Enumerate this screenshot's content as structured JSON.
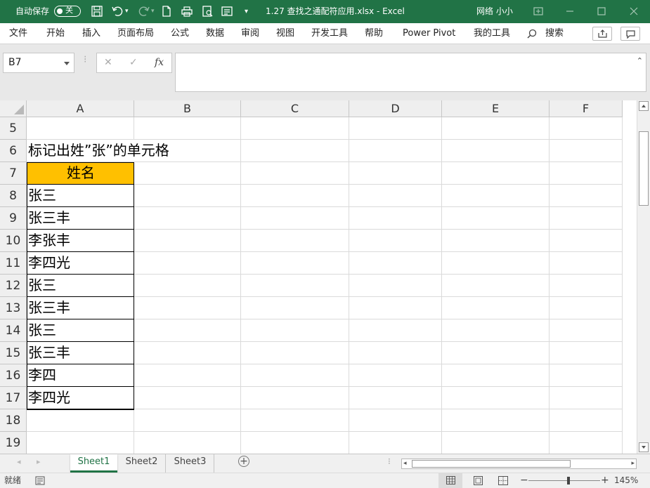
{
  "titlebar": {
    "autosave_label": "自动保存",
    "autosave_state": "关",
    "title": "1.27 查找之通配符应用.xlsx  -  Excel",
    "user": "网络 小小",
    "qat_more": "▾",
    "bg_color": "#217346"
  },
  "menu": {
    "items": [
      "文件",
      "开始",
      "插入",
      "页面布局",
      "公式",
      "数据",
      "审阅",
      "视图",
      "开发工具",
      "帮助",
      "Power Pivot",
      "我的工具"
    ],
    "search": "搜索"
  },
  "formula_bar": {
    "name_box": "B7",
    "cancel": "✕",
    "enter": "✓",
    "fx": "fx",
    "value": ""
  },
  "sheet": {
    "columns": [
      "A",
      "B",
      "C",
      "D",
      "E",
      "F"
    ],
    "rows": [
      {
        "num": "5",
        "a": ""
      },
      {
        "num": "6",
        "a": "标记出姓”张”的单元格"
      },
      {
        "num": "7",
        "a": "姓名"
      },
      {
        "num": "8",
        "a": "张三"
      },
      {
        "num": "9",
        "a": "张三丰"
      },
      {
        "num": "10",
        "a": "李张丰"
      },
      {
        "num": "11",
        "a": "李四光"
      },
      {
        "num": "12",
        "a": "张三"
      },
      {
        "num": "13",
        "a": "张三丰"
      },
      {
        "num": "14",
        "a": "张三"
      },
      {
        "num": "15",
        "a": "张三丰"
      },
      {
        "num": "16",
        "a": "李四"
      },
      {
        "num": "17",
        "a": "李四光"
      },
      {
        "num": "18",
        "a": ""
      },
      {
        "num": "19",
        "a": ""
      }
    ],
    "header_fill": "#FFC000"
  },
  "sheet_tabs": {
    "tabs": [
      "Sheet1",
      "Sheet2",
      "Sheet3"
    ],
    "active": "Sheet1",
    "add": "+"
  },
  "status": {
    "ready": "就绪",
    "zoom_minus": "−",
    "zoom_plus": "+",
    "zoom_level": "145%"
  }
}
